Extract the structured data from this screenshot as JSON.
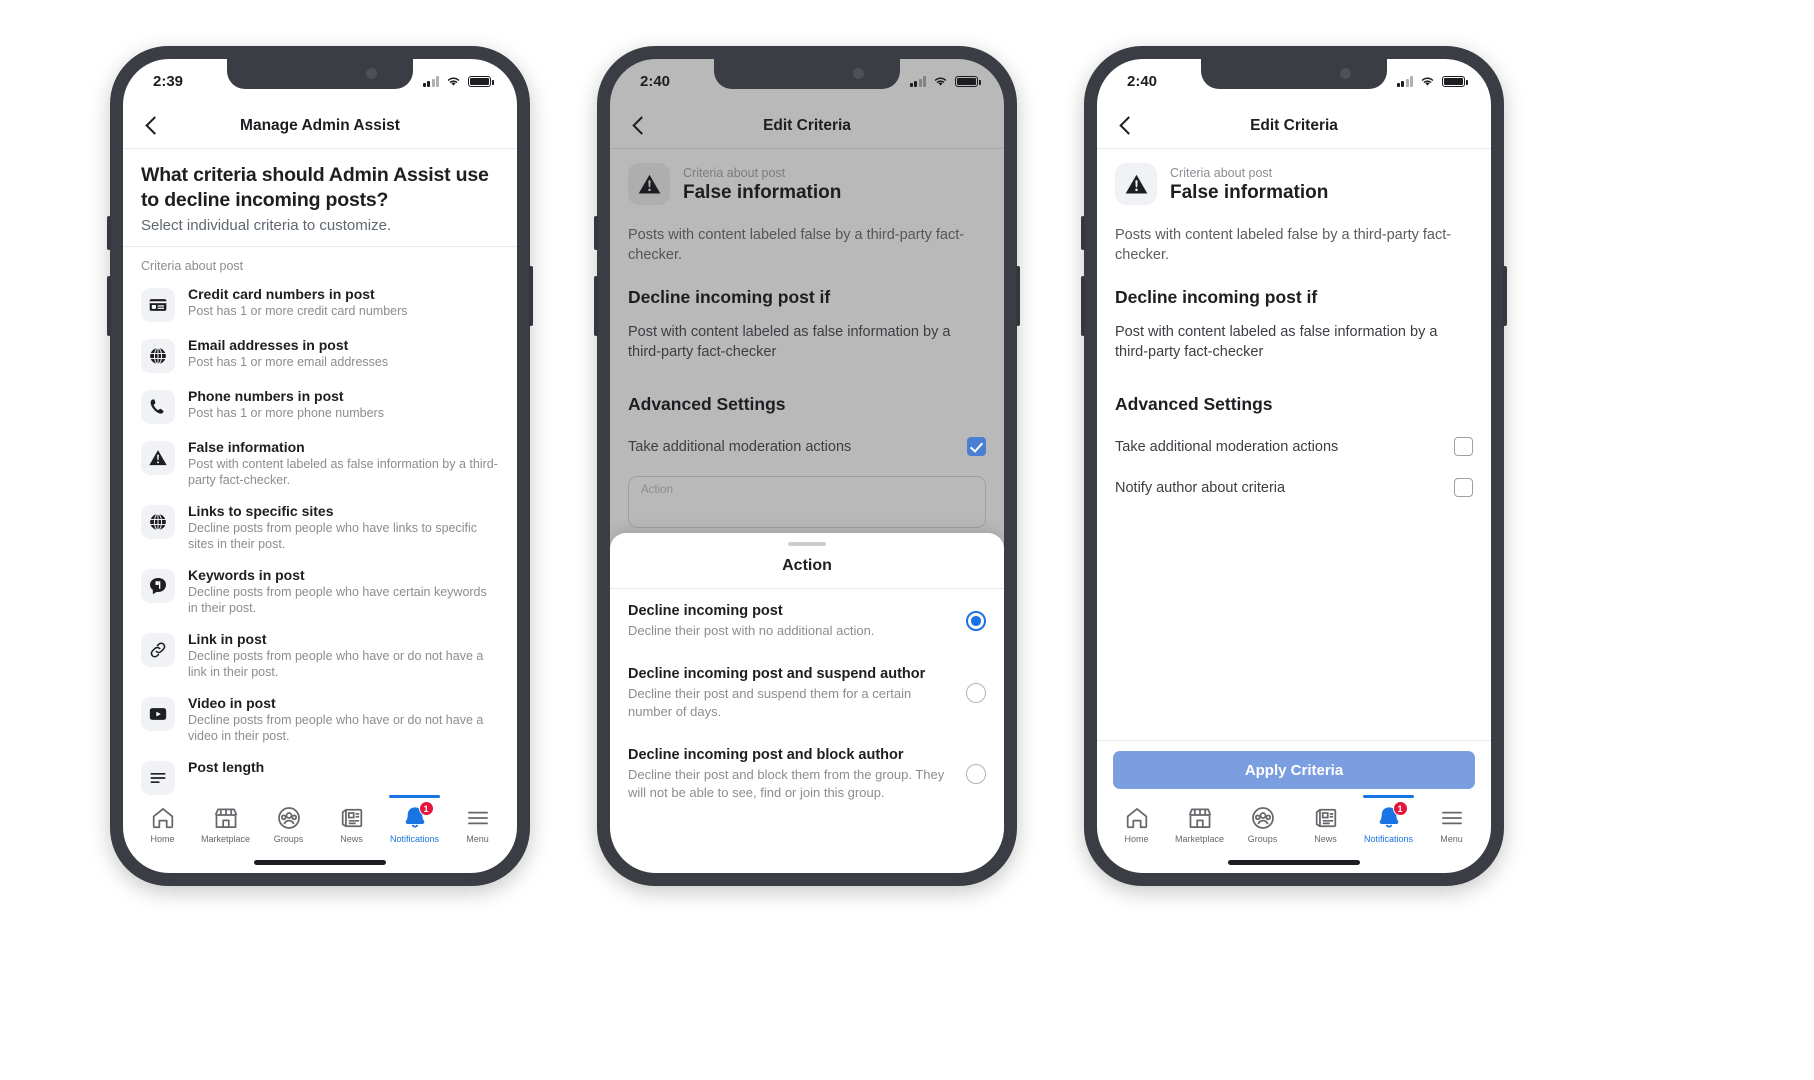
{
  "phones": [
    {
      "id": "phone-manage-admin-assist",
      "status_bar": {
        "time": "2:39"
      },
      "nav": {
        "title": "Manage Admin Assist",
        "back_icon": "chevron-left-icon"
      },
      "intro": {
        "heading": "What criteria should Admin Assist use to decline incoming posts?",
        "subheading": "Select individual criteria to customize."
      },
      "section_label": "Criteria about post",
      "criteria": [
        {
          "icon": "credit-card-icon",
          "title": "Credit card numbers in post",
          "desc": "Post has 1 or more credit card numbers"
        },
        {
          "icon": "globe-icon",
          "title": "Email addresses in post",
          "desc": "Post has 1 or more email addresses"
        },
        {
          "icon": "phone-icon",
          "title": "Phone numbers in post",
          "desc": "Post has 1 or more phone numbers"
        },
        {
          "icon": "warning-triangle-icon",
          "title": "False information",
          "desc": "Post with content labeled as false information by a third-party fact-checker."
        },
        {
          "icon": "globe-icon",
          "title": "Links to specific sites",
          "desc": "Decline posts from people who have links to specific sites in their post."
        },
        {
          "icon": "comment-flag-icon",
          "title": "Keywords in post",
          "desc": "Decline posts from people who have certain keywords in their post."
        },
        {
          "icon": "link-icon",
          "title": "Link in post",
          "desc": "Decline posts from people who have or do not have a link in their post."
        },
        {
          "icon": "video-icon",
          "title": "Video in post",
          "desc": "Decline posts from people who have or do not have a video in their post."
        },
        {
          "icon": "text-length-icon",
          "title": "Post length",
          "desc": ""
        }
      ]
    },
    {
      "id": "phone-edit-criteria-sheet",
      "status_bar": {
        "time": "2:40"
      },
      "nav": {
        "title": "Edit Criteria",
        "back_icon": "chevron-left-icon"
      },
      "detail": {
        "kicker": "Criteria about post",
        "title": "False information",
        "icon": "warning-triangle-icon",
        "body_text": "Posts with content labeled false by a third-party fact-checker.",
        "condition_heading": "Decline incoming post if",
        "condition_text": "Post with content labeled as false information by a third-party fact-checker",
        "advanced_heading": "Advanced Settings",
        "checkboxes": [
          {
            "label": "Take additional moderation actions",
            "checked": true
          }
        ],
        "action_field_label": "Action"
      },
      "sheet": {
        "title": "Action",
        "options": [
          {
            "title": "Decline incoming post",
            "desc": "Decline their post with no additional action.",
            "selected": true
          },
          {
            "title": "Decline incoming post and suspend author",
            "desc": "Decline their post and suspend them for a certain number of days.",
            "selected": false
          },
          {
            "title": "Decline incoming post and block author",
            "desc": "Decline their post and block them from the group. They will not be able to see, find or join this group.",
            "selected": false
          }
        ]
      }
    },
    {
      "id": "phone-edit-criteria-apply",
      "status_bar": {
        "time": "2:40"
      },
      "nav": {
        "title": "Edit Criteria",
        "back_icon": "chevron-left-icon"
      },
      "detail": {
        "kicker": "Criteria about post",
        "title": "False information",
        "icon": "warning-triangle-icon",
        "body_text": "Posts with content labeled false by a third-party fact-checker.",
        "condition_heading": "Decline incoming post if",
        "condition_text": "Post with content labeled as false information by a third-party fact-checker",
        "advanced_heading": "Advanced Settings",
        "checkboxes": [
          {
            "label": "Take additional moderation actions",
            "checked": false
          },
          {
            "label": "Notify author about criteria",
            "checked": false
          }
        ]
      },
      "apply_button": "Apply Criteria"
    }
  ],
  "tabbar": {
    "items": [
      {
        "label": "Home",
        "icon": "home-icon",
        "active": false,
        "badge": ""
      },
      {
        "label": "Marketplace",
        "icon": "storefront-icon",
        "active": false,
        "badge": ""
      },
      {
        "label": "Groups",
        "icon": "groups-icon",
        "active": false,
        "badge": ""
      },
      {
        "label": "News",
        "icon": "news-icon",
        "active": false,
        "badge": ""
      },
      {
        "label": "Notifications",
        "icon": "bell-icon",
        "active": true,
        "badge": "1"
      },
      {
        "label": "Menu",
        "icon": "hamburger-icon",
        "active": false,
        "badge": ""
      }
    ]
  },
  "colors": {
    "accent_blue": "#1b74e4",
    "apply_button_blue": "#7a9ee0",
    "checkbox_blue": "#4a7fd4",
    "badge_red": "#e4153b",
    "text_primary": "#1c1e21",
    "text_secondary": "#8a8d91",
    "icon_chip_bg": "#f0f2f5",
    "dim_overlay": "#b9b9b9"
  }
}
